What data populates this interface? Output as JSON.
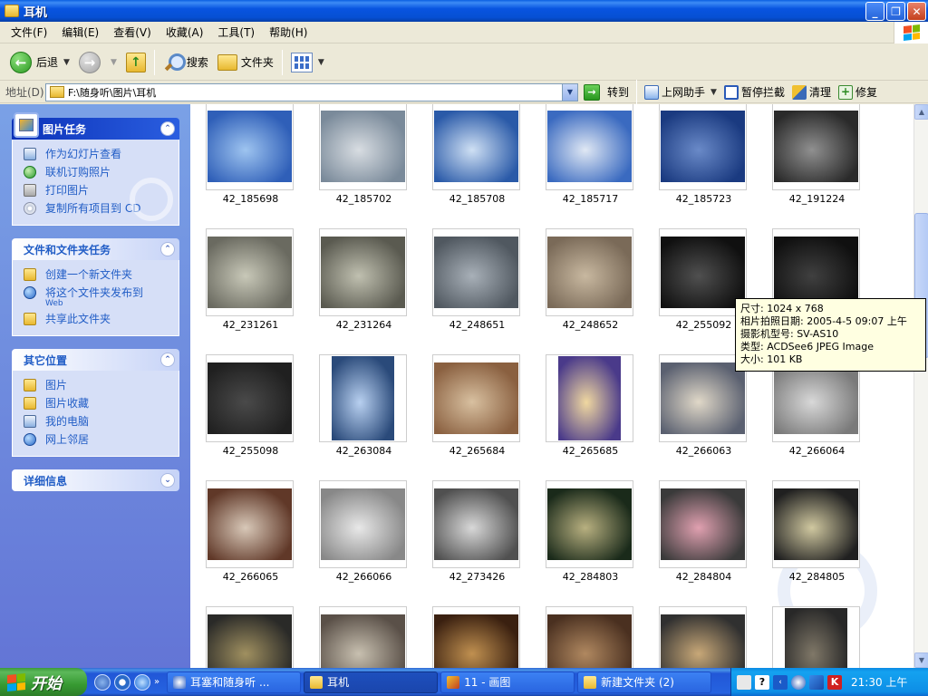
{
  "window": {
    "title": "耳机"
  },
  "menu": [
    "文件(F)",
    "编辑(E)",
    "查看(V)",
    "收藏(A)",
    "工具(T)",
    "帮助(H)"
  ],
  "toolbar": {
    "back": "后退",
    "search": "搜索",
    "folders": "文件夹"
  },
  "address": {
    "label": "地址(D)",
    "path": "F:\\随身听\\图片\\耳机",
    "go": "转到",
    "assistant": "上网助手",
    "block": "暂停拦截",
    "clean": "清理",
    "repair": "修复"
  },
  "left_panel": {
    "picture_tasks": {
      "title": "图片任务",
      "items": [
        "作为幻灯片查看",
        "联机订购照片",
        "打印图片",
        "复制所有项目到 CD"
      ]
    },
    "file_tasks": {
      "title": "文件和文件夹任务",
      "items": [
        "创建一个新文件夹",
        "将这个文件夹发布到",
        "共享此文件夹"
      ],
      "web_sub": "Web"
    },
    "other_places": {
      "title": "其它位置",
      "items": [
        "图片",
        "图片收藏",
        "我的电脑",
        "网上邻居"
      ]
    },
    "details": {
      "title": "详细信息"
    }
  },
  "files": [
    "42_185698",
    "42_185702",
    "42_185708",
    "42_185717",
    "42_185723",
    "42_191224",
    "42_231261",
    "42_231264",
    "42_248651",
    "42_248652",
    "42_255092",
    "",
    "42_255098",
    "42_263084",
    "42_265684",
    "42_265685",
    "42_266063",
    "42_266064",
    "42_266065",
    "42_266066",
    "42_273426",
    "42_284803",
    "42_284804",
    "42_284805"
  ],
  "tooltip": {
    "size": "尺寸: 1024 x 768",
    "date": "相片拍照日期: 2005-4-5 09:07 上午",
    "camera": "摄影机型号: SV-AS10",
    "type": "类型: ACDSee6 JPEG Image",
    "filesize": "大小: 101 KB"
  },
  "taskbar": {
    "start": "开始",
    "tasks": [
      "耳塞和随身听 ...",
      "耳机",
      "11 - 画图",
      "新建文件夹 (2)"
    ],
    "clock": "21:30 上午"
  },
  "colors": {
    "title_blue": "#0854e0",
    "panel_blue": "#6375d6",
    "link_blue": "#215dc6",
    "start_green": "#379a32"
  }
}
